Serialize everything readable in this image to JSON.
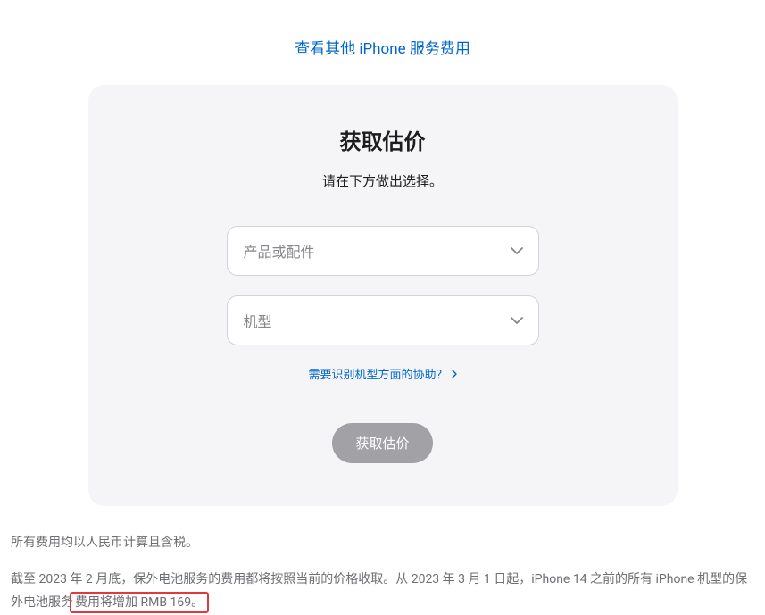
{
  "topLink": "查看其他 iPhone 服务费用",
  "card": {
    "title": "获取估价",
    "subtitle": "请在下方做出选择。",
    "select1Placeholder": "产品或配件",
    "select2Placeholder": "机型",
    "helpLink": "需要识别机型方面的协助？",
    "submitButton": "获取估价"
  },
  "footer": {
    "line1": "所有费用均以人民币计算且含税。",
    "line2_pre": "截至 2023 年 2 月底，保外电池服务的费用都将按照当前的价格收取。从 2023 年 3 月 1 日起，iPhone 14 之前的所有 iPhone 机型的保外电池服务",
    "line2_highlight": "费用将增加 RMB 169。"
  }
}
